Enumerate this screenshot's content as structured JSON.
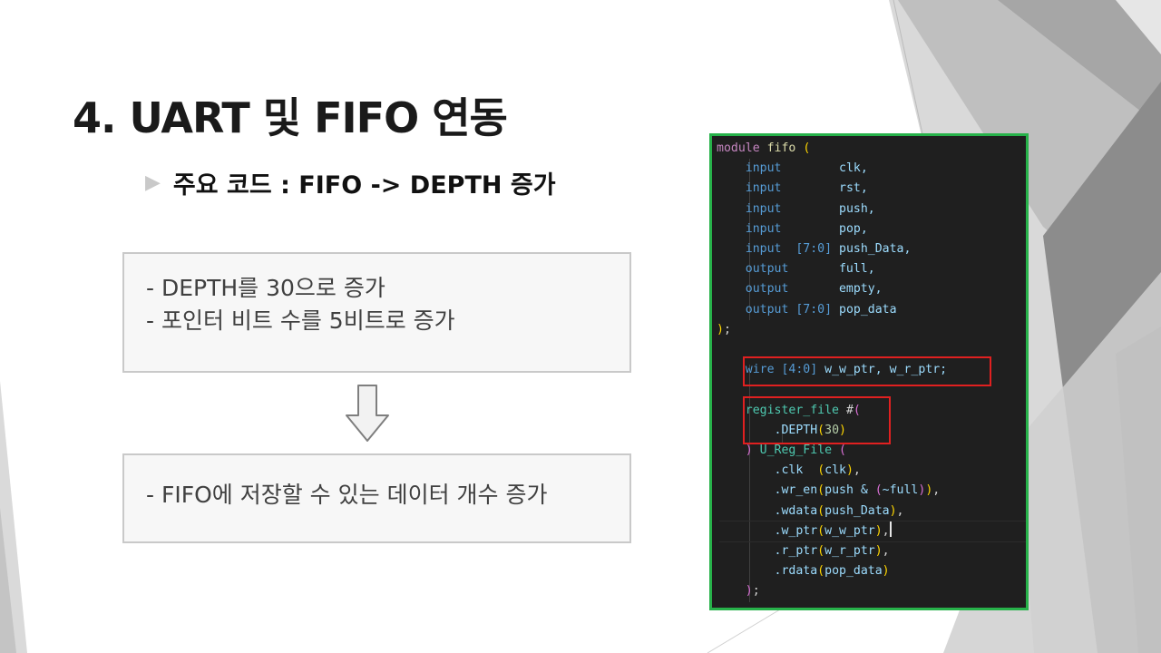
{
  "slide": {
    "title": "4. UART 및 FIFO 연동",
    "subtitle": "주요 코드 : FIFO -> DEPTH 증가",
    "box1": {
      "lines": [
        "- DEPTH를 30으로 증가",
        "- 포인터 비트 수를 5비트로 증가"
      ]
    },
    "box2": {
      "lines": [
        "- FIFO에 저장할 수 있는 데이터 개수 증가"
      ]
    }
  },
  "code": {
    "module_kw": "module",
    "module_name": "fifo",
    "open_paren": "(",
    "ports": [
      {
        "dir": "input",
        "range": "",
        "name": "clk,"
      },
      {
        "dir": "input",
        "range": "",
        "name": "rst,"
      },
      {
        "dir": "input",
        "range": "",
        "name": "push,"
      },
      {
        "dir": "input",
        "range": "",
        "name": "pop,"
      },
      {
        "dir": "input",
        "range": "[7:0]",
        "name": "push_Data,"
      },
      {
        "dir": "output",
        "range": "",
        "name": "full,"
      },
      {
        "dir": "output",
        "range": "",
        "name": "empty,"
      },
      {
        "dir": "output",
        "range": "[7:0]",
        "name": "pop_data"
      }
    ],
    "close_paren": ")",
    "semicolon": ";",
    "wire_kw": "wire",
    "wire_range": "[4:0]",
    "wire_names": "w_w_ptr, w_r_ptr;",
    "reg_module": "register_file",
    "hash": "#",
    "param_name": ".DEPTH",
    "param_value": "30",
    "instance_name": "U_Reg_File",
    "conn": {
      "clk_p": ".clk",
      "clk_s": "clk",
      "wr_en_p": ".wr_en",
      "wr_en_a": "push &",
      "wr_en_b": "~full",
      "wdata_p": ".wdata",
      "wdata_s": "push_Data",
      "w_ptr_p": ".w_ptr",
      "w_ptr_s": "w_w_ptr",
      "r_ptr_p": ".r_ptr",
      "r_ptr_s": "w_r_ptr",
      "rdata_p": ".rdata",
      "rdata_s": "pop_data"
    },
    "end_semicolon": ";"
  }
}
